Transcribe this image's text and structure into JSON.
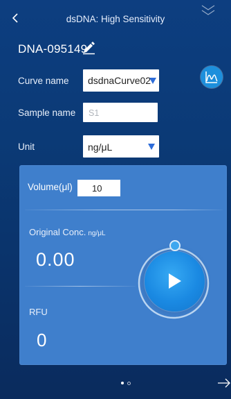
{
  "header": {
    "title": "dsDNA: High Sensitivity"
  },
  "sample": {
    "id": "DNA-095149"
  },
  "form": {
    "curve_label": "Curve name",
    "curve_value": "dsdnaCurve02",
    "sample_label": "Sample name",
    "sample_placeholder": "S1",
    "unit_label": "Unit",
    "unit_value": "ng/μL"
  },
  "panel": {
    "volume_label": "Volume(μl)",
    "volume_value": "10",
    "orig_label": "Original Conc.",
    "orig_unit": "ng/μL",
    "conc_value": "0.00",
    "rfu_label": "RFU",
    "rfu_value": "0"
  },
  "icons": {
    "back": "chevron-left-icon",
    "collapse": "double-chevron-down-icon",
    "edit": "pencil-icon",
    "graph": "curve-graph-icon",
    "play": "play-icon",
    "next": "arrow-right-icon"
  },
  "colors": {
    "accent": "#1d8fdc",
    "panel": "#3f7fcc",
    "dropdown_arrow": "#2d6cd9"
  },
  "pager": {
    "pages": 2,
    "current": 1
  }
}
